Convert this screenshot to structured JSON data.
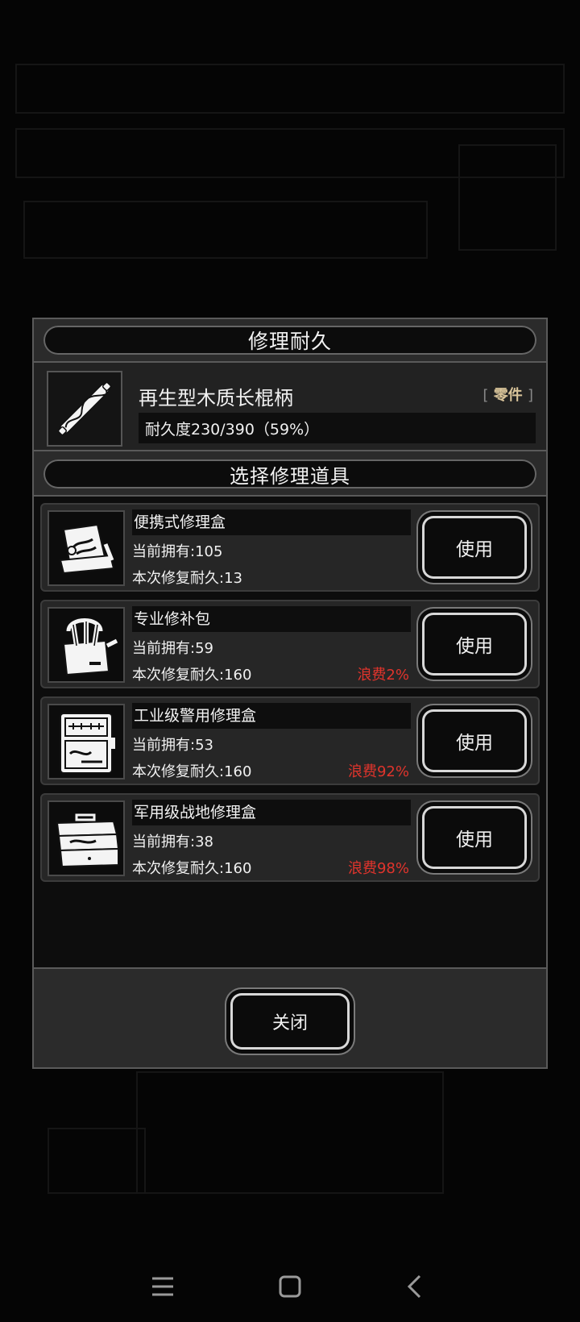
{
  "dialog": {
    "title": "修理耐久",
    "item": {
      "name": "再生型木质长棍柄",
      "tag_open": "[",
      "tag": "零件",
      "tag_close": "]",
      "durability": "耐久度230/390（59%）",
      "icon": "wooden-staff-icon"
    },
    "select_title": "选择修理道具",
    "tools": [
      {
        "name": "便携式修理盒",
        "owned": "当前拥有:105",
        "repair": "本次修复耐久:13",
        "waste": "",
        "button": "使用",
        "icon": "portable-repair-box-icon"
      },
      {
        "name": "专业修补包",
        "owned": "当前拥有:59",
        "repair": "本次修复耐久:160",
        "waste": "浪费2%",
        "button": "使用",
        "icon": "pro-repair-kit-icon"
      },
      {
        "name": "工业级警用修理盒",
        "owned": "当前拥有:53",
        "repair": "本次修复耐久:160",
        "waste": "浪费92%",
        "button": "使用",
        "icon": "industrial-repair-case-icon"
      },
      {
        "name": "军用级战地修理盒",
        "owned": "当前拥有:38",
        "repair": "本次修复耐久:160",
        "waste": "浪费98%",
        "button": "使用",
        "icon": "military-toolbox-icon"
      }
    ],
    "close_label": "关闭"
  },
  "navbar": {
    "menu_icon": "menu-icon",
    "home_icon": "home-icon",
    "back_icon": "back-icon"
  },
  "colors": {
    "waste": "#e0342c",
    "tag": "#d9c49a",
    "panel": "#2b2b2b"
  }
}
